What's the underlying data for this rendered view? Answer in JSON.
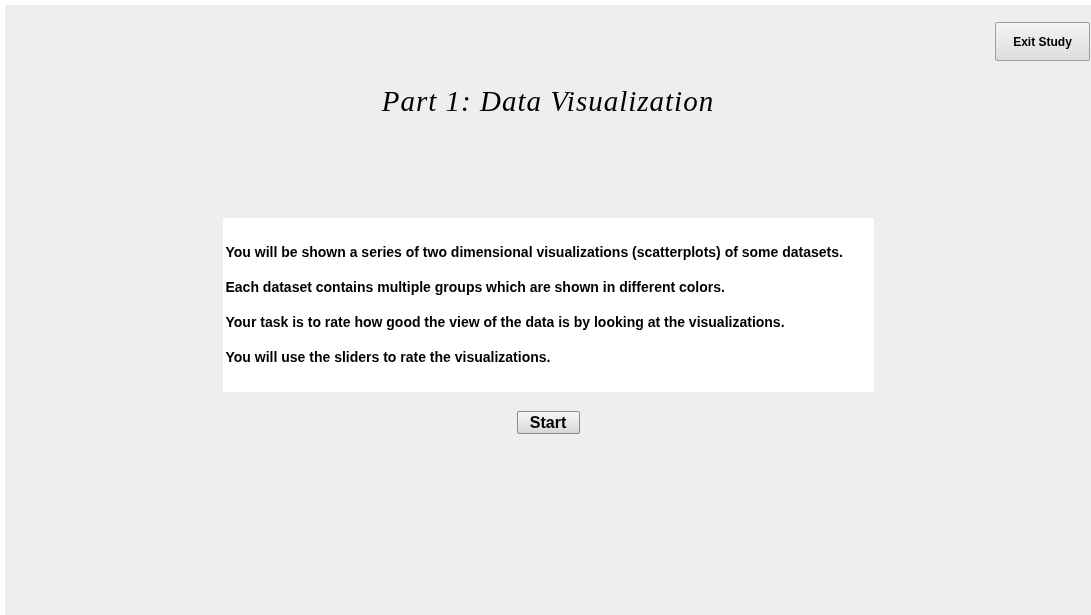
{
  "exit_button": {
    "label": "Exit Study"
  },
  "title": "Part 1: Data Visualization",
  "instructions": [
    "You will be shown a series of two dimensional visualizations (scatterplots) of some datasets.",
    "Each dataset contains multiple groups which are shown in different colors.",
    "Your task is to rate how good the view of the data is by looking at the visualizations.",
    "You will use the sliders to rate the visualizations."
  ],
  "start_button": {
    "label": "Start"
  }
}
